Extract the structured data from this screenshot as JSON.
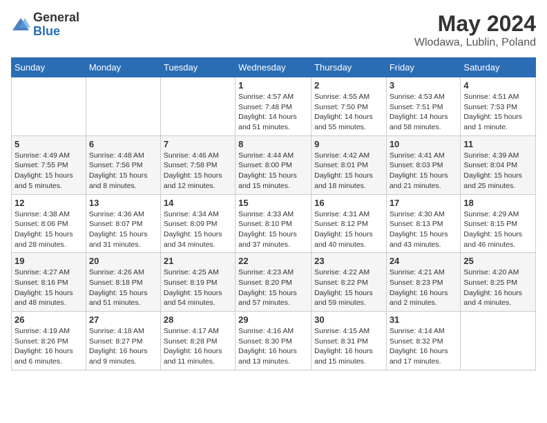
{
  "header": {
    "logo_general": "General",
    "logo_blue": "Blue",
    "month_title": "May 2024",
    "location": "Wlodawa, Lublin, Poland"
  },
  "weekdays": [
    "Sunday",
    "Monday",
    "Tuesday",
    "Wednesday",
    "Thursday",
    "Friday",
    "Saturday"
  ],
  "weeks": [
    [
      {
        "day": "",
        "info": ""
      },
      {
        "day": "",
        "info": ""
      },
      {
        "day": "",
        "info": ""
      },
      {
        "day": "1",
        "info": "Sunrise: 4:57 AM\nSunset: 7:48 PM\nDaylight: 14 hours\nand 51 minutes."
      },
      {
        "day": "2",
        "info": "Sunrise: 4:55 AM\nSunset: 7:50 PM\nDaylight: 14 hours\nand 55 minutes."
      },
      {
        "day": "3",
        "info": "Sunrise: 4:53 AM\nSunset: 7:51 PM\nDaylight: 14 hours\nand 58 minutes."
      },
      {
        "day": "4",
        "info": "Sunrise: 4:51 AM\nSunset: 7:53 PM\nDaylight: 15 hours\nand 1 minute."
      }
    ],
    [
      {
        "day": "5",
        "info": "Sunrise: 4:49 AM\nSunset: 7:55 PM\nDaylight: 15 hours\nand 5 minutes."
      },
      {
        "day": "6",
        "info": "Sunrise: 4:48 AM\nSunset: 7:56 PM\nDaylight: 15 hours\nand 8 minutes."
      },
      {
        "day": "7",
        "info": "Sunrise: 4:46 AM\nSunset: 7:58 PM\nDaylight: 15 hours\nand 12 minutes."
      },
      {
        "day": "8",
        "info": "Sunrise: 4:44 AM\nSunset: 8:00 PM\nDaylight: 15 hours\nand 15 minutes."
      },
      {
        "day": "9",
        "info": "Sunrise: 4:42 AM\nSunset: 8:01 PM\nDaylight: 15 hours\nand 18 minutes."
      },
      {
        "day": "10",
        "info": "Sunrise: 4:41 AM\nSunset: 8:03 PM\nDaylight: 15 hours\nand 21 minutes."
      },
      {
        "day": "11",
        "info": "Sunrise: 4:39 AM\nSunset: 8:04 PM\nDaylight: 15 hours\nand 25 minutes."
      }
    ],
    [
      {
        "day": "12",
        "info": "Sunrise: 4:38 AM\nSunset: 8:06 PM\nDaylight: 15 hours\nand 28 minutes."
      },
      {
        "day": "13",
        "info": "Sunrise: 4:36 AM\nSunset: 8:07 PM\nDaylight: 15 hours\nand 31 minutes."
      },
      {
        "day": "14",
        "info": "Sunrise: 4:34 AM\nSunset: 8:09 PM\nDaylight: 15 hours\nand 34 minutes."
      },
      {
        "day": "15",
        "info": "Sunrise: 4:33 AM\nSunset: 8:10 PM\nDaylight: 15 hours\nand 37 minutes."
      },
      {
        "day": "16",
        "info": "Sunrise: 4:31 AM\nSunset: 8:12 PM\nDaylight: 15 hours\nand 40 minutes."
      },
      {
        "day": "17",
        "info": "Sunrise: 4:30 AM\nSunset: 8:13 PM\nDaylight: 15 hours\nand 43 minutes."
      },
      {
        "day": "18",
        "info": "Sunrise: 4:29 AM\nSunset: 8:15 PM\nDaylight: 15 hours\nand 46 minutes."
      }
    ],
    [
      {
        "day": "19",
        "info": "Sunrise: 4:27 AM\nSunset: 8:16 PM\nDaylight: 15 hours\nand 48 minutes."
      },
      {
        "day": "20",
        "info": "Sunrise: 4:26 AM\nSunset: 8:18 PM\nDaylight: 15 hours\nand 51 minutes."
      },
      {
        "day": "21",
        "info": "Sunrise: 4:25 AM\nSunset: 8:19 PM\nDaylight: 15 hours\nand 54 minutes."
      },
      {
        "day": "22",
        "info": "Sunrise: 4:23 AM\nSunset: 8:20 PM\nDaylight: 15 hours\nand 57 minutes."
      },
      {
        "day": "23",
        "info": "Sunrise: 4:22 AM\nSunset: 8:22 PM\nDaylight: 15 hours\nand 59 minutes."
      },
      {
        "day": "24",
        "info": "Sunrise: 4:21 AM\nSunset: 8:23 PM\nDaylight: 16 hours\nand 2 minutes."
      },
      {
        "day": "25",
        "info": "Sunrise: 4:20 AM\nSunset: 8:25 PM\nDaylight: 16 hours\nand 4 minutes."
      }
    ],
    [
      {
        "day": "26",
        "info": "Sunrise: 4:19 AM\nSunset: 8:26 PM\nDaylight: 16 hours\nand 6 minutes."
      },
      {
        "day": "27",
        "info": "Sunrise: 4:18 AM\nSunset: 8:27 PM\nDaylight: 16 hours\nand 9 minutes."
      },
      {
        "day": "28",
        "info": "Sunrise: 4:17 AM\nSunset: 8:28 PM\nDaylight: 16 hours\nand 11 minutes."
      },
      {
        "day": "29",
        "info": "Sunrise: 4:16 AM\nSunset: 8:30 PM\nDaylight: 16 hours\nand 13 minutes."
      },
      {
        "day": "30",
        "info": "Sunrise: 4:15 AM\nSunset: 8:31 PM\nDaylight: 16 hours\nand 15 minutes."
      },
      {
        "day": "31",
        "info": "Sunrise: 4:14 AM\nSunset: 8:32 PM\nDaylight: 16 hours\nand 17 minutes."
      },
      {
        "day": "",
        "info": ""
      }
    ]
  ]
}
